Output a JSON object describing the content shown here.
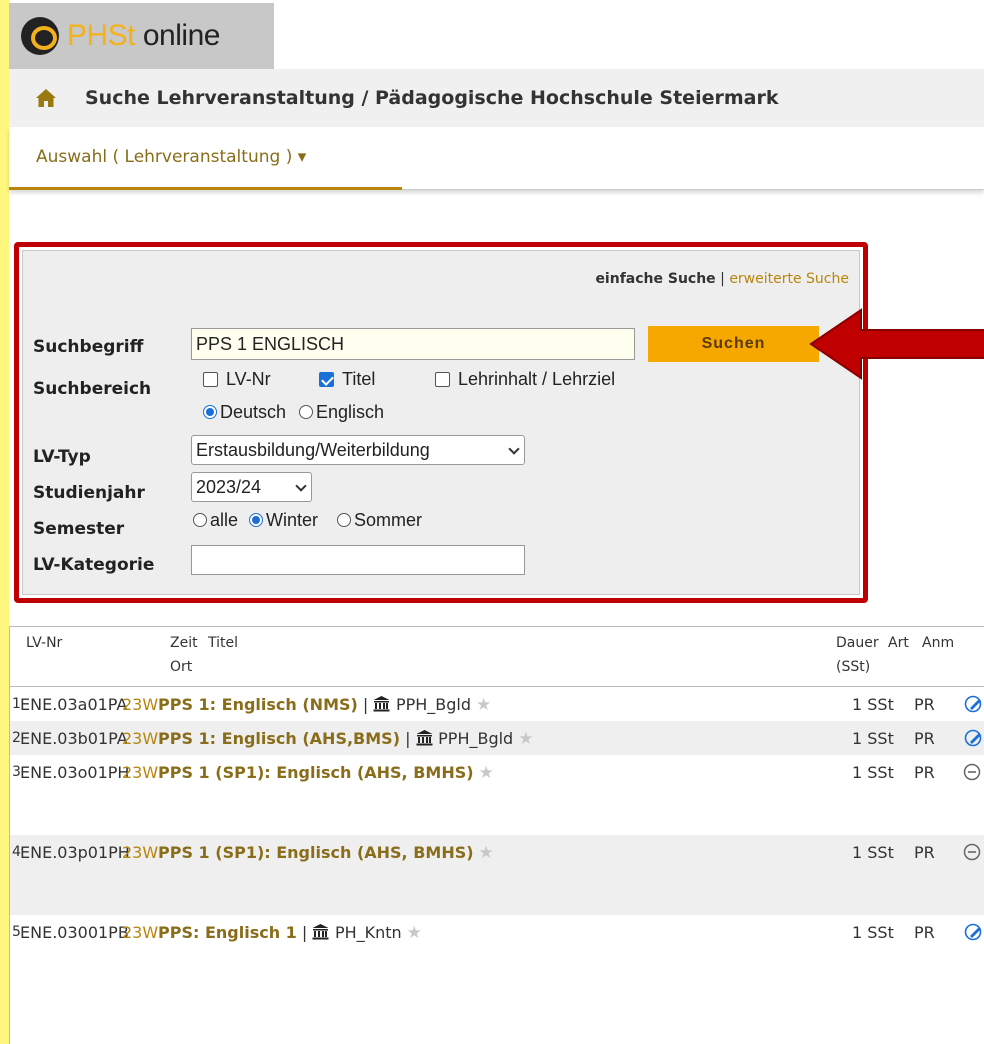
{
  "logo": {
    "brand_a": "PHSt",
    "brand_b": " online"
  },
  "breadcrumb": {
    "text": "Suche Lehrveranstaltung / Pädagogische Hochschule Steiermark"
  },
  "menu": {
    "item": "Auswahl ( Lehrveranstaltung ) ▾"
  },
  "search_mode": {
    "simple": "einfache Suche",
    "separator": " | ",
    "advanced": "erweiterte Suche"
  },
  "form": {
    "suchbegriff_label": "Suchbegriff",
    "suchbegriff_value": "PPS 1 ENGLISCH",
    "search_button": "Suchen",
    "suchbereich_label": "Suchbereich",
    "opt_lvnr": "LV-Nr",
    "opt_titel": "Titel",
    "opt_lehrinhalt": "Lehrinhalt / Lehrziel",
    "lang_de": "Deutsch",
    "lang_en": "Englisch",
    "lvtyp_label": "LV-Typ",
    "lvtyp_value": "Erstausbildung/Weiterbildung",
    "studienjahr_label": "Studienjahr",
    "studienjahr_value": "2023/24",
    "semester_label": "Semester",
    "sem_alle": "alle",
    "sem_winter": "Winter",
    "sem_sommer": "Sommer",
    "lvkategorie_label": "LV-Kategorie",
    "lvkategorie_value": ""
  },
  "results": {
    "headers": {
      "lvnr": "LV-Nr",
      "zeit": "Zeit",
      "titel": "Titel",
      "ort": "Ort",
      "dauer": "Dauer",
      "sst": "(SSt)",
      "art": "Art",
      "anm": "Anm"
    },
    "rows": [
      {
        "num": "1",
        "lvnr": "ENE.03a01PA",
        "time": "23W",
        "title": "PPS 1: Englisch (NMS)",
        "sep": " | ",
        "loc": "PPH_Bgld",
        "dur": "1 SSt",
        "art": "PR",
        "status": "check-circle"
      },
      {
        "num": "2",
        "lvnr": "ENE.03b01PA",
        "time": "23W",
        "title": "PPS 1: Englisch (AHS,BMS)",
        "sep": " | ",
        "loc": "PPH_Bgld",
        "dur": "1 SSt",
        "art": "PR",
        "status": "check-circle"
      },
      {
        "num": "3",
        "lvnr": "ENE.03o01PH",
        "time": "23W",
        "title": "PPS 1 (SP1): Englisch (AHS, BMHS)",
        "sep": "",
        "loc": "",
        "dur": "1 SSt",
        "art": "PR",
        "status": "minus-circle"
      },
      {
        "num": "4",
        "lvnr": "ENE.03p01PH",
        "time": "23W",
        "title": "PPS 1 (SP1): Englisch (AHS, BMHS)",
        "sep": "",
        "loc": "",
        "dur": "1 SSt",
        "art": "PR",
        "status": "minus-circle"
      },
      {
        "num": "5",
        "lvnr": "ENE.03001PB",
        "time": "23W",
        "title": "PPS: Englisch 1",
        "sep": " | ",
        "loc": "PH_Kntn",
        "dur": "1 SSt",
        "art": "PR",
        "status": "check-circle"
      }
    ]
  },
  "colors": {
    "accent": "#f6a800",
    "highlight_border": "#c00000",
    "link": "#b8860b",
    "page_bg": "#fef77e"
  },
  "icons": {
    "home": "home-icon",
    "arrow": "red-arrow-icon",
    "star": "star-icon",
    "museum": "institution-icon"
  }
}
